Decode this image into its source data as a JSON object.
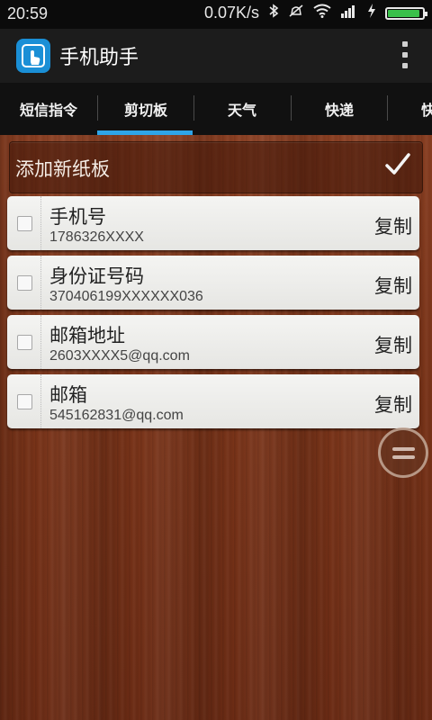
{
  "status": {
    "time": "20:59",
    "network_speed": "0.07K/s",
    "battery_level": 0.92,
    "icons": [
      "bluetooth-icon",
      "mute-icon",
      "wifi-icon",
      "signal-icon",
      "charging-icon",
      "battery-icon"
    ]
  },
  "app": {
    "title": "手机助手"
  },
  "tabs": [
    {
      "label": "短信指令"
    },
    {
      "label": "剪切板"
    },
    {
      "label": "天气"
    },
    {
      "label": "快递"
    },
    {
      "label": "快递"
    }
  ],
  "selected_tab": "剪切板",
  "add_bar": {
    "label": "添加新纸板"
  },
  "clips": [
    {
      "title": "手机号",
      "value": "1786326XXXX",
      "copy_label": "复制"
    },
    {
      "title": "身份证号码",
      "value": "370406199XXXXXX036",
      "copy_label": "复制"
    },
    {
      "title": "邮箱地址",
      "value": "2603XXXX5@qq.com",
      "copy_label": "复制"
    },
    {
      "title": "邮箱",
      "value": "545162831@qq.com",
      "copy_label": "复制"
    }
  ],
  "colors": {
    "accent": "#2ea5e8",
    "app_icon": "#1a8fd6",
    "battery": "#39c04a",
    "wood": "#7a3419"
  }
}
